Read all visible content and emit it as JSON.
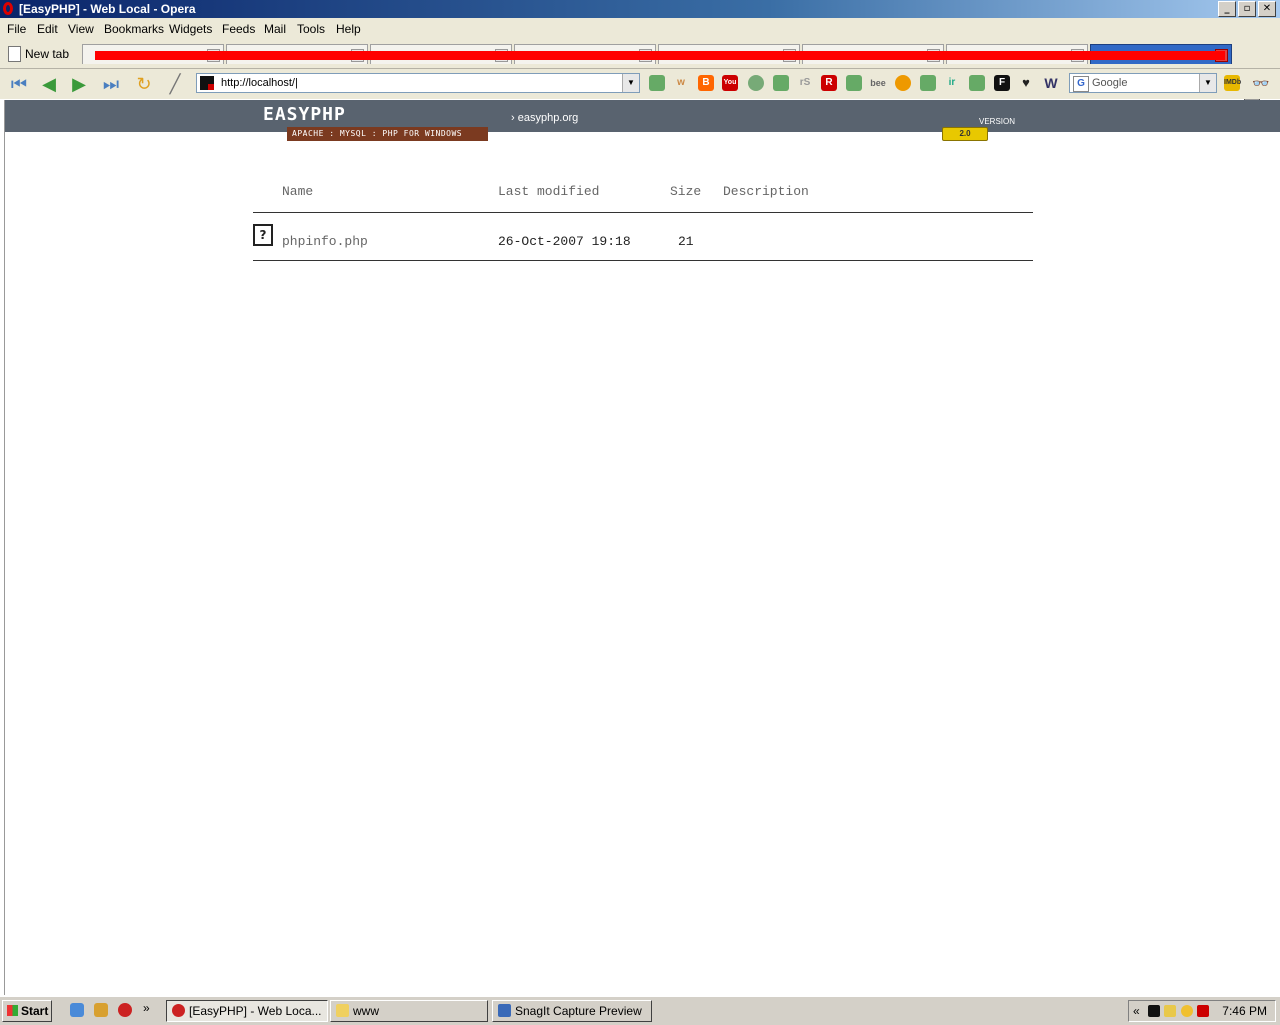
{
  "window": {
    "title": "[EasyPHP] - Web Local - Opera",
    "buttons": [
      "_",
      "▫",
      "✕"
    ]
  },
  "menu": [
    "File",
    "Edit",
    "View",
    "Bookmarks",
    "Widgets",
    "Feeds",
    "Mail",
    "Tools",
    "Help"
  ],
  "tabs": {
    "new_tab_label": "New tab"
  },
  "address_bar": {
    "url": "http://localhost/|"
  },
  "search_bar": {
    "engine": "Google"
  },
  "page": {
    "logo": "EASYPHP",
    "tagline": "APACHE : MYSQL : PHP FOR WINDOWS",
    "site_link": "› easyphp.org",
    "version_label": "VERSION",
    "version_badge": "2.0",
    "listing": {
      "headers": {
        "name": "Name",
        "modified": "Last modified",
        "size": "Size",
        "description": "Description"
      },
      "rows": [
        {
          "name": "phpinfo.php",
          "modified": "26-Oct-2007 19:18",
          "size": "21",
          "description": ""
        }
      ]
    }
  },
  "taskbar": {
    "start": "Start",
    "tasks": [
      {
        "label": "[EasyPHP] - Web Loca...",
        "active": true
      },
      {
        "label": "www",
        "active": false
      },
      {
        "label": "SnagIt Capture Preview",
        "active": false
      }
    ],
    "clock": "7:46 PM",
    "chevron": "«",
    "quicklaunch_more": "»"
  }
}
